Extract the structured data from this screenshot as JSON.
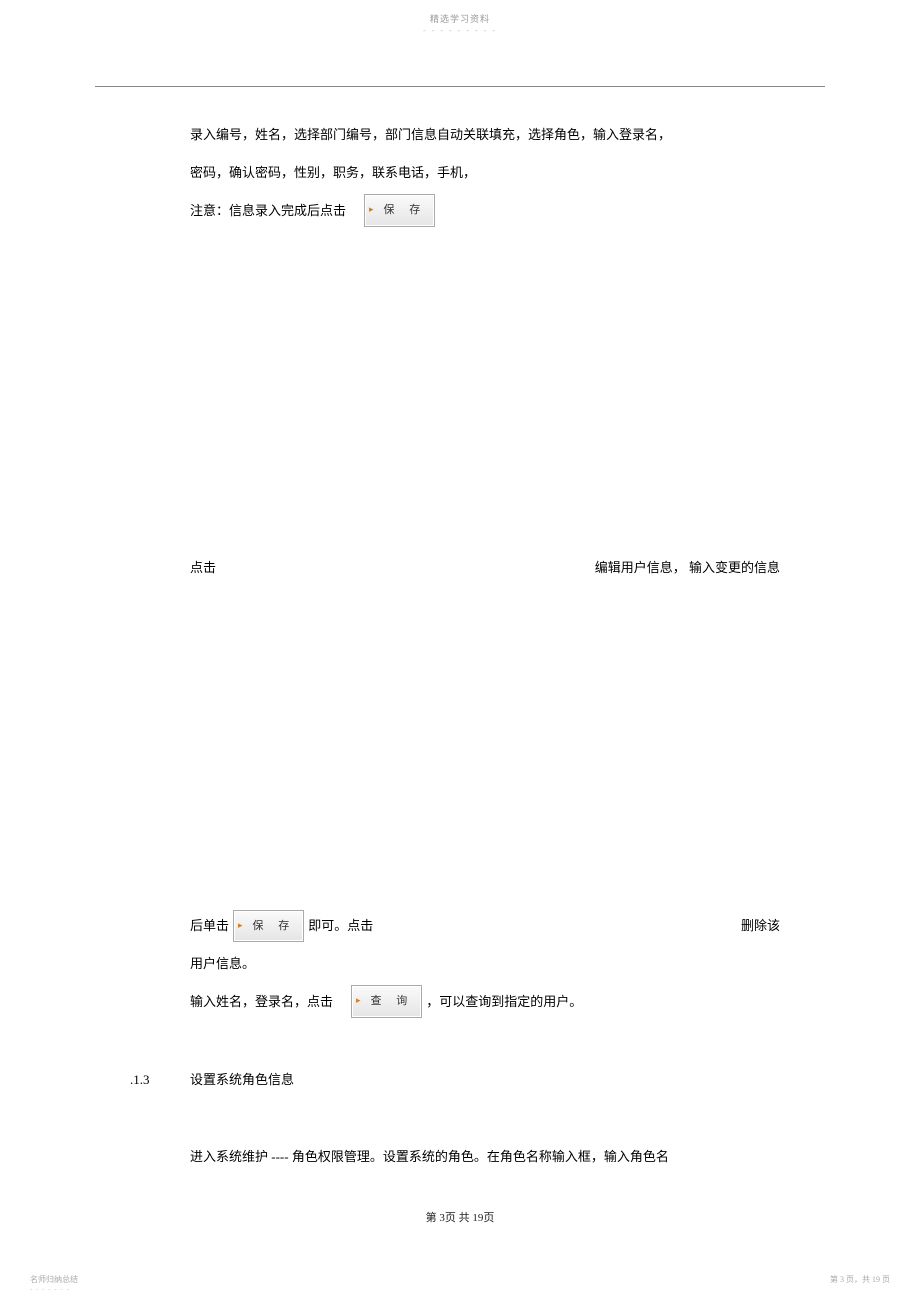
{
  "header": {
    "title": "精选学习资料",
    "dashes": "- - - - - - - - -"
  },
  "body": {
    "p1": "录入编号，姓名，选择部门编号，部门信息自动关联填充，选择角色，输入登录名，",
    "p2": "密码，确认密码，性别，职务，联系电话，手机，",
    "p3_before": "注意：信息录入完成后点击",
    "btn_save": "保 存",
    "p4_left": "点击",
    "p4_right": "编辑用户信息， 输入变更的信息",
    "p5_before": "后单击",
    "p5_mid": "即可。点击",
    "p5_right": "删除该",
    "p6": "用户信息。",
    "p7_before": "输入姓名，登录名，点击",
    "btn_query": "查 询",
    "p7_after": "，可以查询到指定的用户。",
    "section_num": ".1.3",
    "section_title": "设置系统角色信息",
    "p8": "进入系统维护 ---- 角色权限管理。设置系统的角色。在角色名称输入框，输入角色名"
  },
  "footer": {
    "center": "第 3页 共 19页",
    "left": "名师归纳总结",
    "left_dashes": "- - - - - - -",
    "right": "第 3 页，共 19 页"
  }
}
